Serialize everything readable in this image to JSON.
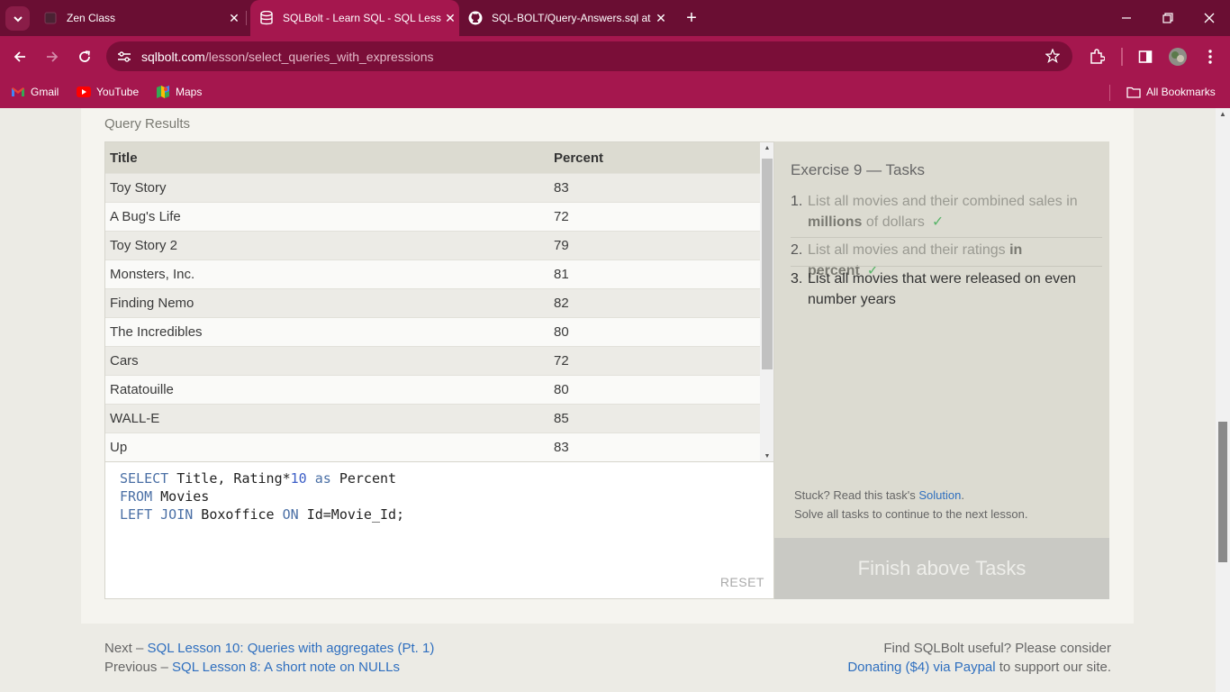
{
  "browser": {
    "tabs": [
      {
        "title": "Zen Class",
        "favicon": "zen-class-favicon"
      },
      {
        "title": "SQLBolt - Learn SQL - SQL Lesson",
        "favicon": "database-icon",
        "active": true
      },
      {
        "title": "SQL-BOLT/Query-Answers.sql at",
        "favicon": "github-icon"
      }
    ],
    "url_host": "sqlbolt.com",
    "url_path": "/lesson/select_queries_with_expressions",
    "bookmarks": [
      {
        "label": "Gmail",
        "icon": "gmail-icon"
      },
      {
        "label": "YouTube",
        "icon": "youtube-icon"
      },
      {
        "label": "Maps",
        "icon": "maps-icon"
      }
    ],
    "all_bookmarks": "All Bookmarks",
    "colors": {
      "frame": "#6a0e33",
      "toolbar": "#a5174e",
      "omnibox": "#7a0e38"
    }
  },
  "query_results": {
    "label": "Query Results",
    "columns": [
      "Title",
      "Percent"
    ],
    "rows": [
      [
        "Toy Story",
        "83"
      ],
      [
        "A Bug's Life",
        "72"
      ],
      [
        "Toy Story 2",
        "79"
      ],
      [
        "Monsters, Inc.",
        "81"
      ],
      [
        "Finding Nemo",
        "82"
      ],
      [
        "The Incredibles",
        "80"
      ],
      [
        "Cars",
        "72"
      ],
      [
        "Ratatouille",
        "80"
      ],
      [
        "WALL-E",
        "85"
      ],
      [
        "Up",
        "83"
      ]
    ]
  },
  "editor": {
    "lines": [
      [
        {
          "k": "kw",
          "t": "SELECT"
        },
        {
          "k": "",
          "t": " Title, Rating*"
        },
        {
          "k": "num",
          "t": "10"
        },
        {
          "k": "",
          "t": " "
        },
        {
          "k": "kw",
          "t": "as"
        },
        {
          "k": "",
          "t": " Percent"
        }
      ],
      [
        {
          "k": "kw",
          "t": "FROM"
        },
        {
          "k": "",
          "t": " Movies"
        }
      ],
      [
        {
          "k": "kw",
          "t": "LEFT JOIN"
        },
        {
          "k": "",
          "t": " Boxoffice "
        },
        {
          "k": "kw",
          "t": "ON"
        },
        {
          "k": "",
          "t": " Id=Movie_Id;"
        }
      ]
    ],
    "reset_label": "RESET"
  },
  "tasks": {
    "title": "Exercise 9 — Tasks",
    "items": [
      {
        "num": "1.",
        "text_before": "List all movies and their combined sales in ",
        "bold": "millions",
        "text_after": " of dollars",
        "done": true,
        "check": "✓"
      },
      {
        "num": "2.",
        "text_before": "List all movies and their ratings ",
        "bold": "in percent",
        "text_after": "",
        "done": true,
        "check": "✓"
      },
      {
        "num": "3.",
        "text_before": "List all movies that were released on even number years",
        "bold": "",
        "text_after": "",
        "done": false,
        "check": ""
      }
    ],
    "stuck_text": "Stuck? Read this task's ",
    "solution_link": "Solution",
    "solution_period": ".",
    "solve_all": "Solve all tasks to continue to the next lesson.",
    "finish_button": "Finish above Tasks"
  },
  "footer": {
    "next_prefix": "Next – ",
    "next_link": "SQL Lesson 10: Queries with aggregates (Pt. 1)",
    "prev_prefix": "Previous – ",
    "prev_link": "SQL Lesson 8: A short note on NULLs",
    "useful_text": "Find SQLBolt useful? Please consider",
    "donate_link": "Donating ($4) via Paypal",
    "donate_suffix": " to support our site."
  }
}
